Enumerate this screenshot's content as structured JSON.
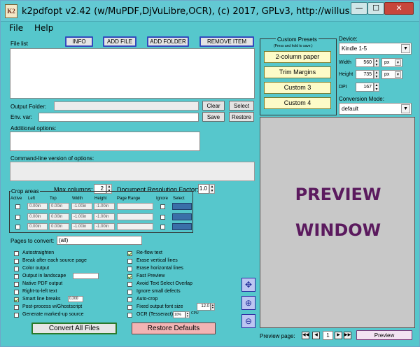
{
  "window": {
    "title": "k2pdfopt v2.42 (w/MuPDF,DjVuLibre,OCR), (c) 2017, GPLv3, http://willus.com",
    "icon_text": "K2",
    "min": "—",
    "max": "☐",
    "close": "✕"
  },
  "menu": {
    "file": "File",
    "help": "Help"
  },
  "file_section": {
    "label": "File list",
    "info": "INFO",
    "add_file": "ADD FILE",
    "add_folder": "ADD FOLDER",
    "remove_item": "REMOVE ITEM"
  },
  "output": {
    "folder_label": "Output Folder:",
    "clear": "Clear",
    "select": "Select",
    "env_label": "Env. var:",
    "save": "Save",
    "restore": "Restore"
  },
  "additional": {
    "label": "Additional options:"
  },
  "cmdline": {
    "label": "Command-line version of options:"
  },
  "crop": {
    "frame_label": "Crop areas",
    "max_columns_label": "Max columns:",
    "max_columns_value": "2",
    "doc_res_label": "Document Resolution Factor:",
    "doc_res_value": "1.0",
    "headers": {
      "active": "Active",
      "left": "Left",
      "top": "Top",
      "width": "Width",
      "height": "Height",
      "page_range": "Page Range",
      "ignore": "Ignore",
      "select": "Select"
    },
    "rows": [
      {
        "left": "0.00in",
        "top": "0.00in",
        "width": "-1.00in",
        "height": "-1.00in",
        "sel": "Select"
      },
      {
        "left": "0.00in",
        "top": "0.00in",
        "width": "-1.00in",
        "height": "-1.00in",
        "sel": "Select"
      },
      {
        "left": "0.00in",
        "top": "0.00in",
        "width": "-1.00in",
        "height": "-1.00in",
        "sel": "Select"
      }
    ]
  },
  "pages": {
    "label": "Pages to convert:",
    "value": "(all)"
  },
  "options_left": [
    {
      "label": "Autostraighten",
      "checked": false
    },
    {
      "label": "Break after each source page",
      "checked": false
    },
    {
      "label": "Color output",
      "checked": false
    },
    {
      "label": "Output in landscape",
      "checked": false
    },
    {
      "label": "Native PDF output",
      "checked": false
    },
    {
      "label": "Right-to-left text",
      "checked": false
    },
    {
      "label": "Smart line breaks",
      "checked": true,
      "value": "0.200"
    },
    {
      "label": "Post-process w/Ghostscript",
      "checked": false
    },
    {
      "label": "Generate marked-up source",
      "checked": false
    }
  ],
  "options_right": [
    {
      "label": "Re-flow text",
      "checked": true
    },
    {
      "label": "Erase vertical lines",
      "checked": false
    },
    {
      "label": "Erase horizontal lines",
      "checked": false
    },
    {
      "label": "Fast Preview",
      "checked": true
    },
    {
      "label": "Avoid Text Select Overlap",
      "checked": false
    },
    {
      "label": "Ignore small defects",
      "checked": false
    },
    {
      "label": "Auto-crop",
      "checked": false
    },
    {
      "label": "Fixed output font size",
      "checked": false,
      "value": "12.0"
    },
    {
      "label": "OCR (Tesseract)",
      "checked": false,
      "value": "10%",
      "suffix": "CPU"
    }
  ],
  "buttons": {
    "convert_all": "Convert All Files",
    "restore_defaults": "Restore Defaults"
  },
  "presets": {
    "title": "Custom Presets",
    "subtitle": "(Press and hold to save.)",
    "items": [
      "2-column paper",
      "Trim Margins",
      "Custom 3",
      "Custom 4"
    ]
  },
  "device": {
    "label": "Device:",
    "value": "Kindle 1-5",
    "width_label": "Width",
    "width_value": "560",
    "width_unit": "px",
    "height_label": "Height",
    "height_value": "735",
    "height_unit": "px",
    "dpi_label": "DPI",
    "dpi_value": "167"
  },
  "conversion": {
    "label": "Conversion Mode:",
    "value": "default"
  },
  "preview": {
    "line1": "PREVIEW",
    "line2": "WINDOW",
    "page_label": "Preview page:",
    "page_value": "1",
    "button": "Preview"
  },
  "colors": {
    "background": "#56c7cc",
    "preview_text": "#5b1a5e",
    "preset_fill": "#fdfbc8"
  }
}
